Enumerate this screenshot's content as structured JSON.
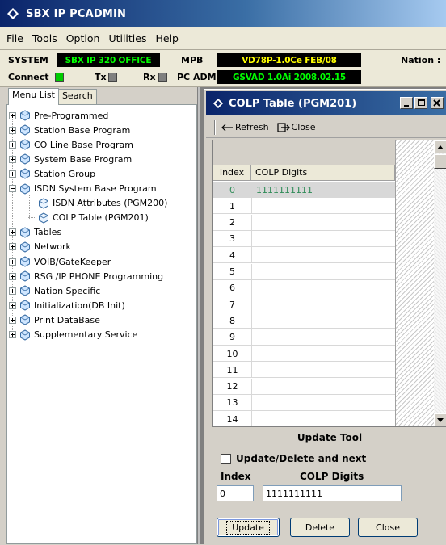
{
  "app": {
    "title": "SBX IP PCADMIN"
  },
  "menu": {
    "items": [
      "File",
      "Tools",
      "Option",
      "Utilities",
      "Help"
    ]
  },
  "status": {
    "system_label": "SYSTEM",
    "system_value": "SBX IP 320 OFFICE",
    "mpb_label": "MPB",
    "mpb_value": "VD78P-1.0Ce FEB/08",
    "nation_label": "Nation :",
    "connect_label": "Connect",
    "tx_label": "Tx",
    "rx_label": "Rx",
    "pcadm_label": "PC ADM",
    "pcadm_value": "GSVAD 1.0Ai 2008.02.15",
    "colors": {
      "connect_led": "#00cc00",
      "idle_led": "#808080",
      "system_text": "#00ff00",
      "mpb_text": "#ffff00",
      "pcadm_text": "#00ff00"
    }
  },
  "left_panel": {
    "tabs": [
      "Menu List",
      "Search"
    ],
    "tree": [
      {
        "label": "Pre-Programmed",
        "level": 0,
        "expander": "plus"
      },
      {
        "label": "Station Base Program",
        "level": 0,
        "expander": "plus"
      },
      {
        "label": "CO Line Base Program",
        "level": 0,
        "expander": "plus"
      },
      {
        "label": "System Base Program",
        "level": 0,
        "expander": "plus"
      },
      {
        "label": "Station Group",
        "level": 0,
        "expander": "plus"
      },
      {
        "label": "ISDN System Base Program",
        "level": 0,
        "expander": "minus"
      },
      {
        "label": "ISDN Attributes (PGM200)",
        "level": 1,
        "expander": "none"
      },
      {
        "label": "COLP Table (PGM201)",
        "level": 1,
        "expander": "none"
      },
      {
        "label": "Tables",
        "level": 0,
        "expander": "plus"
      },
      {
        "label": "Network",
        "level": 0,
        "expander": "plus"
      },
      {
        "label": "VOIB/GateKeeper",
        "level": 0,
        "expander": "plus"
      },
      {
        "label": "RSG /IP PHONE Programming",
        "level": 0,
        "expander": "plus"
      },
      {
        "label": "Nation Specific",
        "level": 0,
        "expander": "plus"
      },
      {
        "label": "Initialization(DB Init)",
        "level": 0,
        "expander": "plus"
      },
      {
        "label": "Print DataBase",
        "level": 0,
        "expander": "plus"
      },
      {
        "label": "Supplementary Service",
        "level": 0,
        "expander": "plus"
      }
    ]
  },
  "child_window": {
    "title": "COLP Table (PGM201)",
    "toolbar": {
      "refresh": "Refresh",
      "close": "Close"
    },
    "grid": {
      "columns": [
        "Index",
        "COLP Digits"
      ],
      "rows": [
        {
          "index": "0",
          "digits": "1111111111"
        },
        {
          "index": "1",
          "digits": ""
        },
        {
          "index": "2",
          "digits": ""
        },
        {
          "index": "3",
          "digits": ""
        },
        {
          "index": "4",
          "digits": ""
        },
        {
          "index": "5",
          "digits": ""
        },
        {
          "index": "6",
          "digits": ""
        },
        {
          "index": "7",
          "digits": ""
        },
        {
          "index": "8",
          "digits": ""
        },
        {
          "index": "9",
          "digits": ""
        },
        {
          "index": "10",
          "digits": ""
        },
        {
          "index": "11",
          "digits": ""
        },
        {
          "index": "12",
          "digits": ""
        },
        {
          "index": "13",
          "digits": ""
        },
        {
          "index": "14",
          "digits": ""
        }
      ]
    },
    "update_tool": {
      "title": "Update Tool",
      "checkbox_label": "Update/Delete and next",
      "index_label": "Index",
      "digits_label": "COLP Digits",
      "index_value": "0",
      "digits_value": "1111111111",
      "buttons": {
        "update": "Update",
        "delete": "Delete",
        "close": "Close"
      }
    }
  }
}
